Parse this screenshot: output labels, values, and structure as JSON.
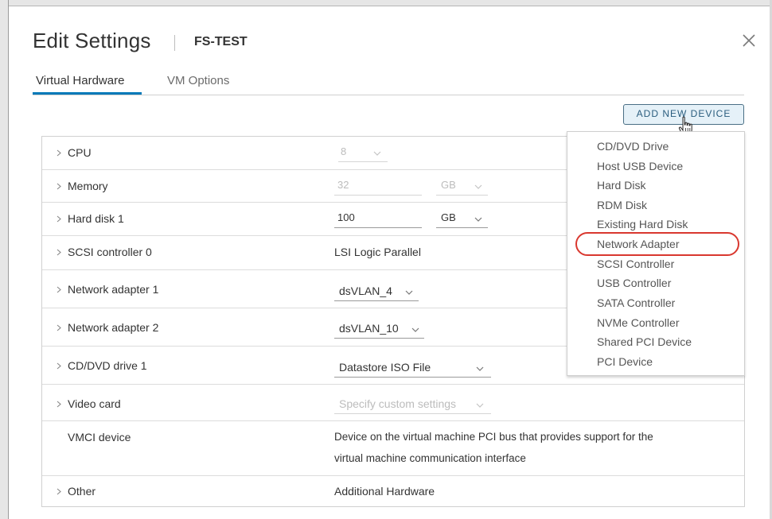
{
  "dialog": {
    "title": "Edit Settings",
    "vm_name": "FS-TEST",
    "close_icon": "close-icon"
  },
  "tabs": [
    {
      "label": "Virtual Hardware",
      "active": true
    },
    {
      "label": "VM Options",
      "active": false
    }
  ],
  "toolbar": {
    "add_device_label": "ADD NEW DEVICE"
  },
  "hardware": {
    "cpu": {
      "label": "CPU",
      "value": "8"
    },
    "memory": {
      "label": "Memory",
      "value": "32",
      "unit": "GB"
    },
    "hard_disk": {
      "label": "Hard disk 1",
      "value": "100",
      "unit": "GB"
    },
    "scsi": {
      "label": "SCSI controller 0",
      "value": "LSI Logic Parallel"
    },
    "net1": {
      "label": "Network adapter 1",
      "value": "dsVLAN_4"
    },
    "net2": {
      "label": "Network adapter 2",
      "value": "dsVLAN_10"
    },
    "cd": {
      "label": "CD/DVD drive 1",
      "value": "Datastore ISO File"
    },
    "video": {
      "label": "Video card",
      "value": "Specify custom settings"
    },
    "vmci": {
      "label": "VMCI device",
      "value_line1": "Device on the virtual machine PCI bus that provides support for the",
      "value_line2": "virtual machine communication interface"
    },
    "other": {
      "label": "Other",
      "value": "Additional Hardware"
    }
  },
  "device_menu": {
    "items": [
      "CD/DVD Drive",
      "Host USB Device",
      "Hard Disk",
      "RDM Disk",
      "Existing Hard Disk",
      "Network Adapter",
      "SCSI Controller",
      "USB Controller",
      "SATA Controller",
      "NVMe Controller",
      "Shared PCI Device",
      "PCI Device"
    ],
    "highlighted": "Network Adapter"
  },
  "colors": {
    "accent": "#0079b8",
    "highlight": "#d9382f",
    "button_bg": "#e5f1f8"
  }
}
